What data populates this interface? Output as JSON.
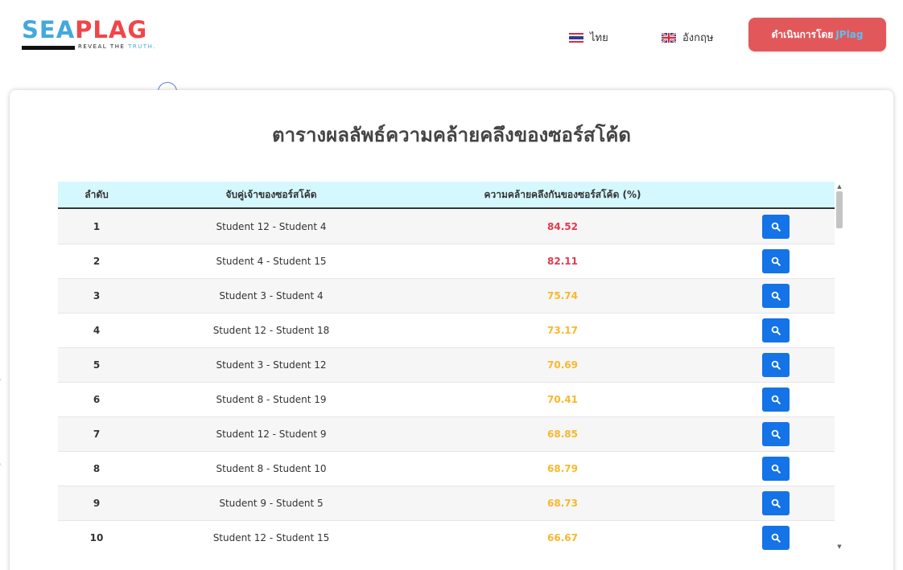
{
  "brand": {
    "logo_sea": "SEA",
    "logo_plag": "PLAG",
    "tagline_prefix": "REVEAL THE ",
    "tagline_highlight": "TRUTH.",
    "colors": {
      "sea": "#43a9dc",
      "plag": "#f0464a"
    }
  },
  "nav": {
    "lang_th": "ไทย",
    "lang_en": "อังกฤษ",
    "powered_prefix": "ดำเนินการโดย",
    "powered_name": "JPlag"
  },
  "page": {
    "title": "ตารางผลลัพธ์ความคล้ายคลึงของซอร์สโค้ด"
  },
  "table": {
    "headers": {
      "rank": "ลำดับ",
      "pair": "จับคู่เจ้าของซอร์สโค้ด",
      "score": "ความคล้ายคลึงกันของซอร์สโค้ด (%)"
    },
    "rows": [
      {
        "rank": "1",
        "pair": "Student 12 - Student 4",
        "score": "84.52",
        "level": "high"
      },
      {
        "rank": "2",
        "pair": "Student 4 - Student 15",
        "score": "82.11",
        "level": "high"
      },
      {
        "rank": "3",
        "pair": "Student 3 - Student 4",
        "score": "75.74",
        "level": "mid"
      },
      {
        "rank": "4",
        "pair": "Student 12 - Student 18",
        "score": "73.17",
        "level": "mid"
      },
      {
        "rank": "5",
        "pair": "Student 3 - Student 12",
        "score": "70.69",
        "level": "mid"
      },
      {
        "rank": "6",
        "pair": "Student 8 - Student 19",
        "score": "70.41",
        "level": "mid"
      },
      {
        "rank": "7",
        "pair": "Student 12 - Student 9",
        "score": "68.85",
        "level": "mid"
      },
      {
        "rank": "8",
        "pair": "Student 8 - Student 10",
        "score": "68.79",
        "level": "mid"
      },
      {
        "rank": "9",
        "pair": "Student 9 - Student 5",
        "score": "68.73",
        "level": "mid"
      },
      {
        "rank": "10",
        "pair": "Student 12 - Student 15",
        "score": "66.67",
        "level": "mid"
      }
    ],
    "action_icon": "search-icon",
    "colors": {
      "high": "#e2394d",
      "mid": "#f7b82c",
      "button": "#1473e6",
      "header_bg": "#d5f8fe"
    }
  }
}
